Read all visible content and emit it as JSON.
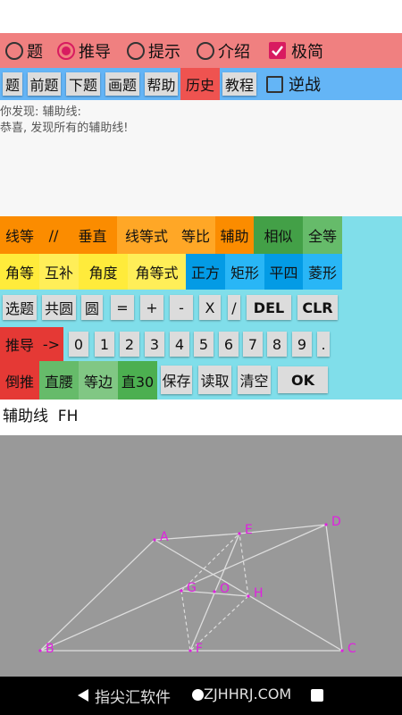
{
  "modes": [
    {
      "label": "题",
      "selected": false
    },
    {
      "label": "推导",
      "selected": true
    },
    {
      "label": "提示",
      "selected": false
    },
    {
      "label": "介绍",
      "selected": false
    }
  ],
  "simple_mode": {
    "label": "极简",
    "checked": true
  },
  "menu": {
    "items": [
      "题",
      "前题",
      "下题",
      "画题",
      "帮助",
      "历史",
      "教程"
    ],
    "active": "历史",
    "reverse": {
      "label": "逆战",
      "checked": false
    }
  },
  "info": {
    "line1": "你发现:  辅助线:",
    "line2": "恭喜, 发现所有的辅助线!"
  },
  "keypad": {
    "row1": [
      "线等",
      "//",
      "垂直",
      "线等式",
      "等比",
      "辅助",
      "相似",
      "全等"
    ],
    "row2": [
      "角等",
      "互补",
      "角度",
      "角等式",
      "正方",
      "矩形",
      "平四",
      "菱形"
    ],
    "row3": [
      "选题",
      "共圆",
      "圆",
      "=",
      "+",
      "-",
      "X",
      "/",
      "DEL",
      "CLR"
    ],
    "row4": [
      "推导",
      "->",
      "0",
      "1",
      "2",
      "3",
      "4",
      "5",
      "6",
      "7",
      "8",
      "9",
      "."
    ],
    "row5": [
      "倒推",
      "直腰",
      "等边",
      "直30",
      "保存",
      "读取",
      "清空",
      "OK"
    ]
  },
  "formula": "辅助线  FH",
  "figure": {
    "points": [
      "A",
      "B",
      "C",
      "D",
      "E",
      "F",
      "G",
      "H",
      "O"
    ],
    "line_color": "#dddddd",
    "label_color": "#e020e0"
  },
  "nav": {
    "back_icon": "back-triangle-icon",
    "watermark_left": "指尖汇软件",
    "watermark_right": "ZJHHRJ.COM",
    "home_icon": "home-circle-icon",
    "recents_icon": "recents-square-icon"
  },
  "colors": {
    "mode_bar": "#f08080",
    "menu_bar": "#64b5f6",
    "keypad_bg": "#80deea",
    "accent": "#d81b60",
    "canvas": "#999999"
  }
}
